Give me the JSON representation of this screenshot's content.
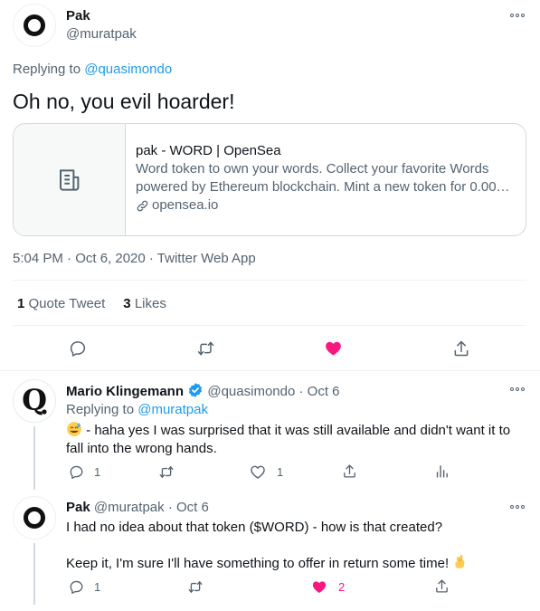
{
  "main_tweet": {
    "author_name": "Pak",
    "author_handle": "@muratpak",
    "replying_label": "Replying to ",
    "replying_to": "@quasimondo",
    "text": "Oh no, you evil hoarder!",
    "card": {
      "title": "pak - WORD | OpenSea",
      "desc_line1": "Word token to own your words. Collect your favorite Words",
      "desc_line2": "powered by Ethereum blockchain. Mint a new token for 0.00…",
      "domain": "opensea.io"
    },
    "timestamp": "5:04 PM · Oct 6, 2020 · Twitter Web App",
    "quote_count": "1",
    "quote_label": "Quote Tweet",
    "like_count": "3",
    "like_label": "Likes"
  },
  "reply1": {
    "author_name": "Mario Klingemann",
    "author_handle": "@quasimondo",
    "sep": "·",
    "date": "Oct 6",
    "replying_label": "Replying to ",
    "replying_to": "@muratpak",
    "text_line1": " -  haha yes I was surprised that it was still available and didn't want it to",
    "text_line2": "fall into the wrong hands.",
    "reply_count": "1",
    "retweet_count": "",
    "like_count": "1"
  },
  "reply2": {
    "author_name": "Pak",
    "author_handle": "@muratpak",
    "sep": "·",
    "date": "Oct 6",
    "text_line1": "I had no idea about that token ($WORD) - how is that created?",
    "text_line2": "Keep it, I'm sure I'll have something to offer in return some time! ",
    "reply_count": "1",
    "like_count": "2"
  },
  "colors": {
    "like_active": "#f91880",
    "link": "#1d9bf0",
    "muted": "#536471",
    "verified": "#1d9bf0"
  },
  "icons": [
    "more-icon",
    "document-icon",
    "link-icon",
    "reply-icon",
    "retweet-icon",
    "heart-icon",
    "share-icon",
    "analytics-icon",
    "verified-icon",
    "sweat-smile-emoji",
    "crossed-fingers-emoji"
  ]
}
